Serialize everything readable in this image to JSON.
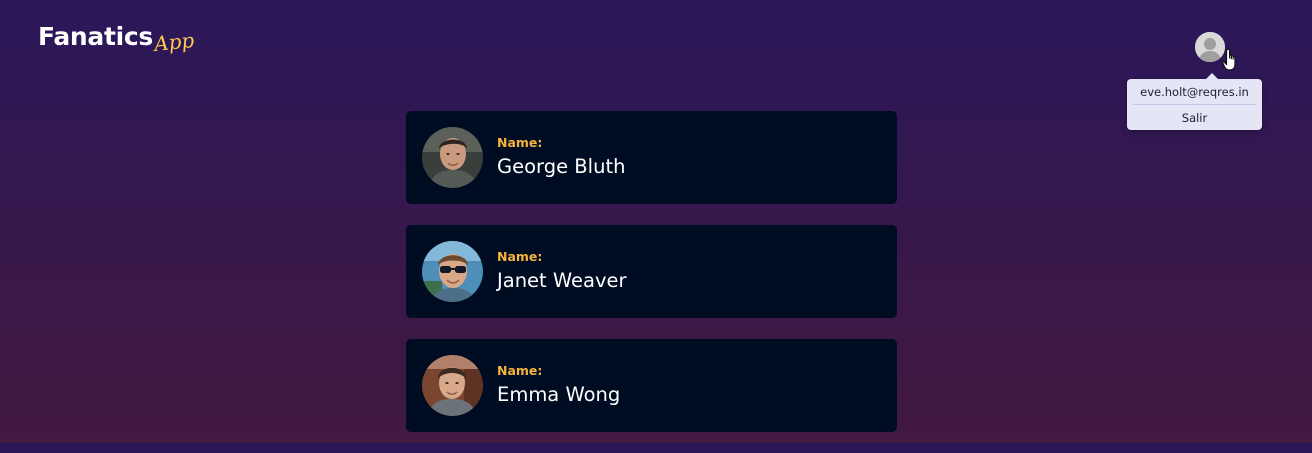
{
  "brand": {
    "main": "Fanatics",
    "script": "App"
  },
  "user_menu": {
    "email": "eve.holt@reqres.in",
    "logout_label": "Salir",
    "avatar_icon": "user-avatar-icon"
  },
  "users": [
    {
      "label": "Name:",
      "name": "George Bluth"
    },
    {
      "label": "Name:",
      "name": "Janet Weaver"
    },
    {
      "label": "Name:",
      "name": "Emma Wong"
    }
  ],
  "colors": {
    "accent": "#f6b43d",
    "card_background": "#000c21",
    "menu_background": "#e4e6f6"
  }
}
